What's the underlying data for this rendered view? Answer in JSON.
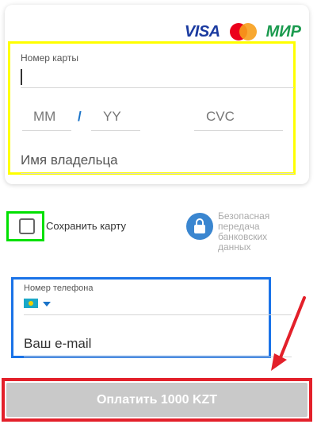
{
  "brands": {
    "visa": "VISA",
    "mastercard": "mastercard",
    "mir": "МИР"
  },
  "card_form": {
    "card_number_label": "Номер карты",
    "card_number_value": "",
    "month_placeholder": "MM",
    "separator": "/",
    "year_placeholder": "YY",
    "cvc_placeholder": "CVC",
    "holder_placeholder": "Имя владельца"
  },
  "save_card": {
    "label": "Сохранить карту",
    "checked": false
  },
  "secure": {
    "lines": [
      "Безопасная",
      "передача",
      "банковских",
      "данных"
    ]
  },
  "contact": {
    "phone_label": "Номер телефона",
    "country_flag": "kazakhstan-flag",
    "email_placeholder": "Ваш e-mail"
  },
  "pay_button": {
    "label": "Оплатить 1000 KZT"
  },
  "colors": {
    "highlight_yellow": "#ffff00",
    "highlight_green": "#00e000",
    "highlight_blue": "#1a73e8",
    "highlight_red": "#e3202a",
    "accent": "#1a73c8",
    "button_disabled": "#c9c9c9"
  }
}
